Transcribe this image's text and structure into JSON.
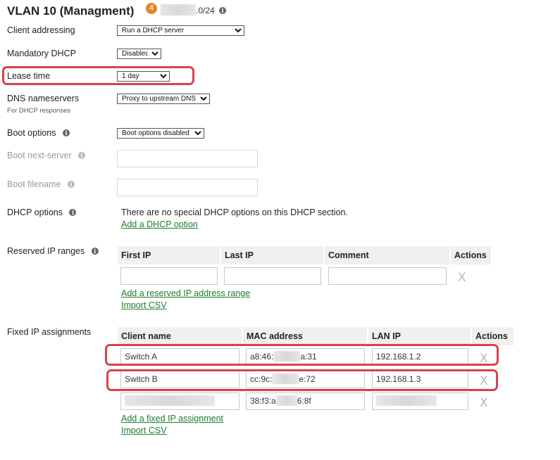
{
  "section": {
    "title": "VLAN 10 (Managment)",
    "badge": "4",
    "subnet_suffix": ".0/24"
  },
  "fields": {
    "client_addressing": {
      "label": "Client addressing",
      "value": "Run a DHCP server"
    },
    "mandatory_dhcp": {
      "label": "Mandatory DHCP",
      "value": "Disabled"
    },
    "lease_time": {
      "label": "Lease time",
      "value": "1 day"
    },
    "dns_nameservers": {
      "label": "DNS nameservers",
      "sublabel": "For DHCP responses",
      "value": "Proxy to upstream DNS"
    },
    "boot_options": {
      "label": "Boot options",
      "value": "Boot options disabled"
    },
    "boot_next_server": {
      "label": "Boot next-server"
    },
    "boot_filename": {
      "label": "Boot filename"
    },
    "dhcp_options": {
      "label": "DHCP options",
      "text": "There are no special DHCP options on this DHCP section.",
      "add_link": "Add a DHCP option"
    }
  },
  "reserved_ranges": {
    "label": "Reserved IP ranges",
    "columns": [
      "First IP",
      "Last IP",
      "Comment",
      "Actions"
    ],
    "add_link": "Add a reserved IP address range",
    "import_link": "Import CSV",
    "remove_glyph": "X"
  },
  "fixed_assignments": {
    "label": "Fixed IP assignments",
    "columns": [
      "Client name",
      "MAC address",
      "LAN IP",
      "Actions"
    ],
    "rows": [
      {
        "name": "Switch A",
        "mac_start": "a8:46:",
        "mac_end": "a:31",
        "ip": "192.168.1.2"
      },
      {
        "name": "Switch B",
        "mac_start": "cc:9c:",
        "mac_end": "e:72",
        "ip": "192.168.1.3"
      },
      {
        "name": "",
        "mac_start": "38:f3:a",
        "mac_end": "6:8f",
        "ip": ""
      }
    ],
    "add_link": "Add a fixed IP assignment",
    "import_link": "Import CSV",
    "remove_glyph": "X"
  },
  "colors": {
    "highlight": "#d9424a",
    "link": "#1e7d2e",
    "badge": "#e8832a"
  }
}
